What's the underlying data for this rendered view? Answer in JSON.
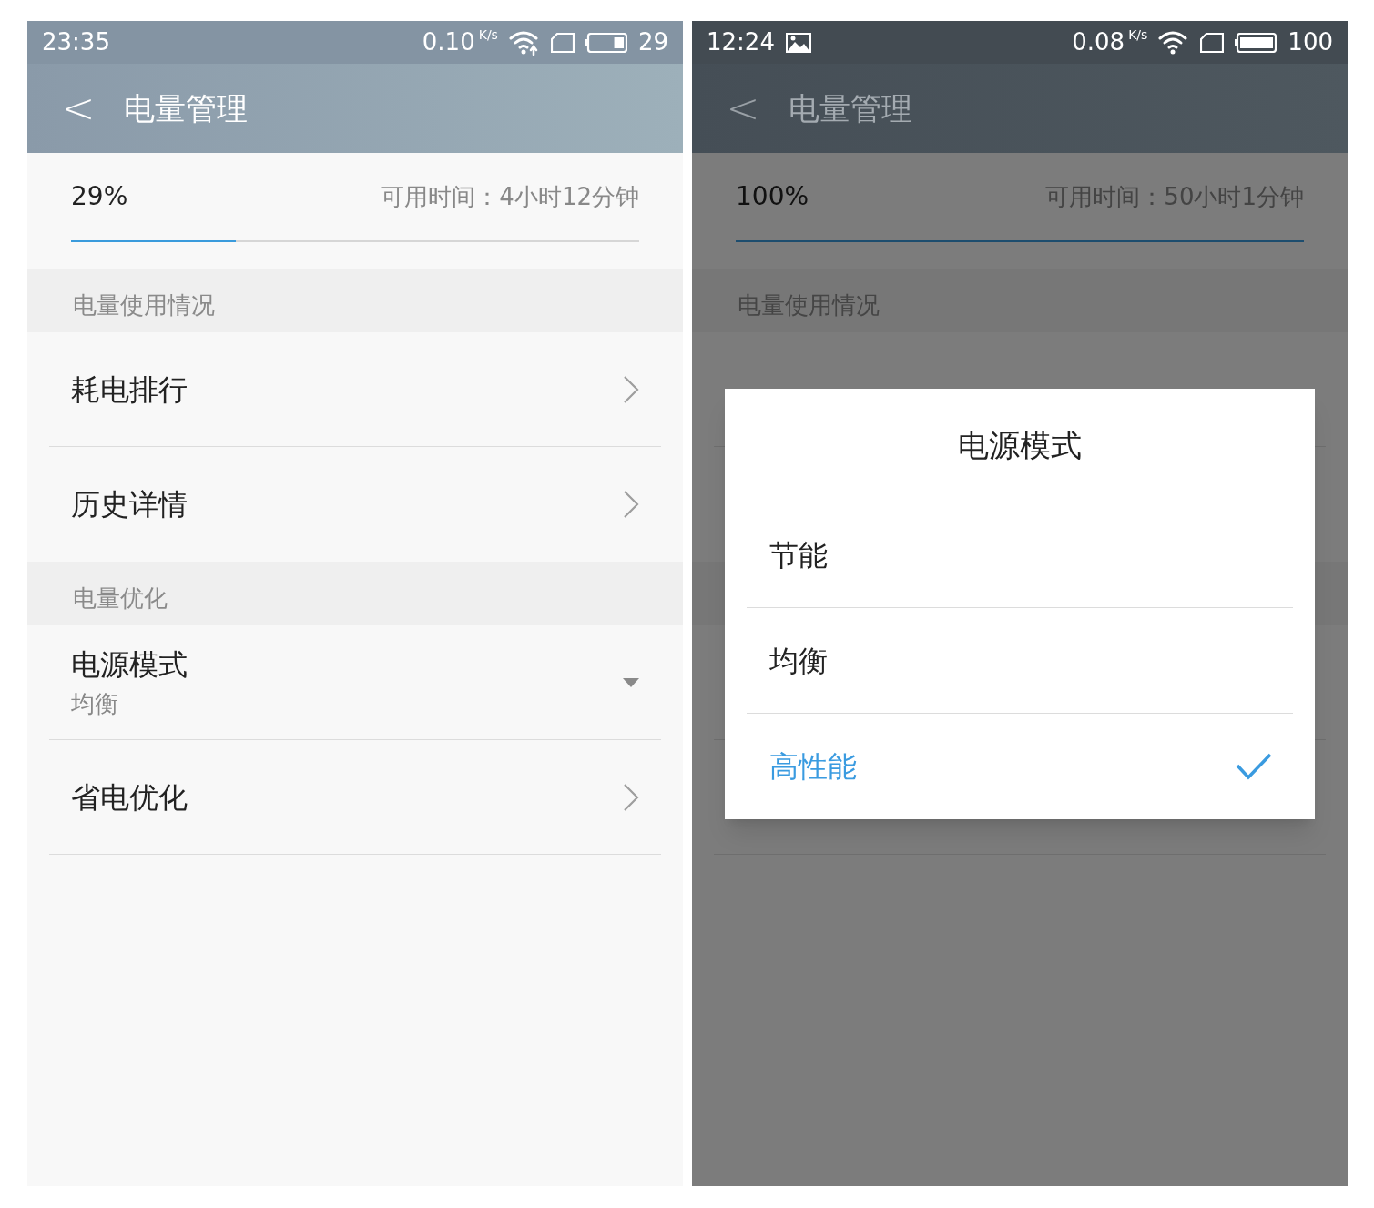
{
  "screens": [
    {
      "status_bar": {
        "time": "23:35",
        "net_speed": "0.10",
        "net_unit": "K/s",
        "battery": "29",
        "wifi_upload": true
      },
      "header": {
        "back": "<",
        "title": "电量管理"
      },
      "battery": {
        "percent": "29%",
        "remaining": "可用时间：4小时12分钟",
        "level": 0.29
      },
      "sections": [
        {
          "title": "电量使用情况",
          "items": [
            {
              "kind": "link",
              "label": "耗电排行"
            },
            {
              "kind": "link",
              "label": "历史详情"
            }
          ]
        },
        {
          "title": "电量优化",
          "items": [
            {
              "kind": "dropdown",
              "label": "电源模式",
              "value": "均衡"
            },
            {
              "kind": "link",
              "label": "省电优化"
            }
          ]
        }
      ]
    },
    {
      "status_bar": {
        "time": "12:24",
        "image_notification": true,
        "net_speed": "0.08",
        "net_unit": "K/s",
        "battery": "100",
        "wifi_upload": false
      },
      "header": {
        "back": "<",
        "title": "电量管理"
      },
      "battery": {
        "percent": "100%",
        "remaining": "可用时间：50小时1分钟",
        "level": 1.0
      },
      "sections": [
        {
          "title": "电量使用情况",
          "items": [
            {
              "kind": "covered"
            },
            {
              "kind": "covered"
            }
          ]
        },
        {
          "items": [
            {
              "kind": "covered"
            },
            {
              "kind": "covered"
            }
          ]
        }
      ],
      "dialog": {
        "title": "电源模式",
        "options": [
          {
            "label": "节能",
            "selected": false
          },
          {
            "label": "均衡",
            "selected": false
          },
          {
            "label": "高性能",
            "selected": true
          }
        ]
      }
    }
  ]
}
